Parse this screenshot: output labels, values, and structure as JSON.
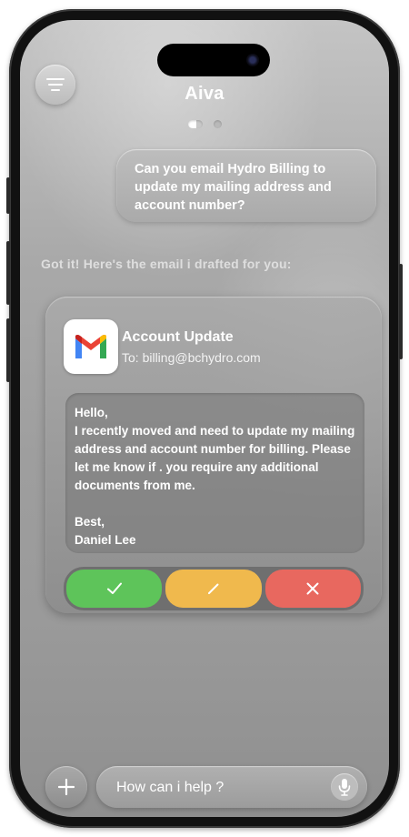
{
  "app": {
    "title": "Aiva"
  },
  "pager": {
    "count": 2,
    "active_index": 0
  },
  "chat": {
    "user_message": "Can you email Hydro Billing to update my mailing address and account number?",
    "assistant_message": "Got it! Here's the email i drafted for you:"
  },
  "email_card": {
    "app_icon": "gmail-icon",
    "subject": "Account Update",
    "to": "To: billing@bchydro.com",
    "body_lines": [
      "Hello,",
      "I recently moved and need to update my mailing address and account number for billing. Please let me know if . you require any additional documents from me.",
      "",
      "Best,",
      "Daniel Lee"
    ],
    "actions": [
      {
        "name": "approve",
        "icon": "check-icon",
        "color": "#5ec45a"
      },
      {
        "name": "edit",
        "icon": "pencil-icon",
        "color": "#f0b94d"
      },
      {
        "name": "reject",
        "icon": "close-icon",
        "color": "#e8685f"
      }
    ]
  },
  "composer": {
    "placeholder": "How can i help ?",
    "add_icon": "plus-icon",
    "mic_icon": "microphone-icon"
  },
  "icons": {
    "menu": "menu-icon"
  }
}
